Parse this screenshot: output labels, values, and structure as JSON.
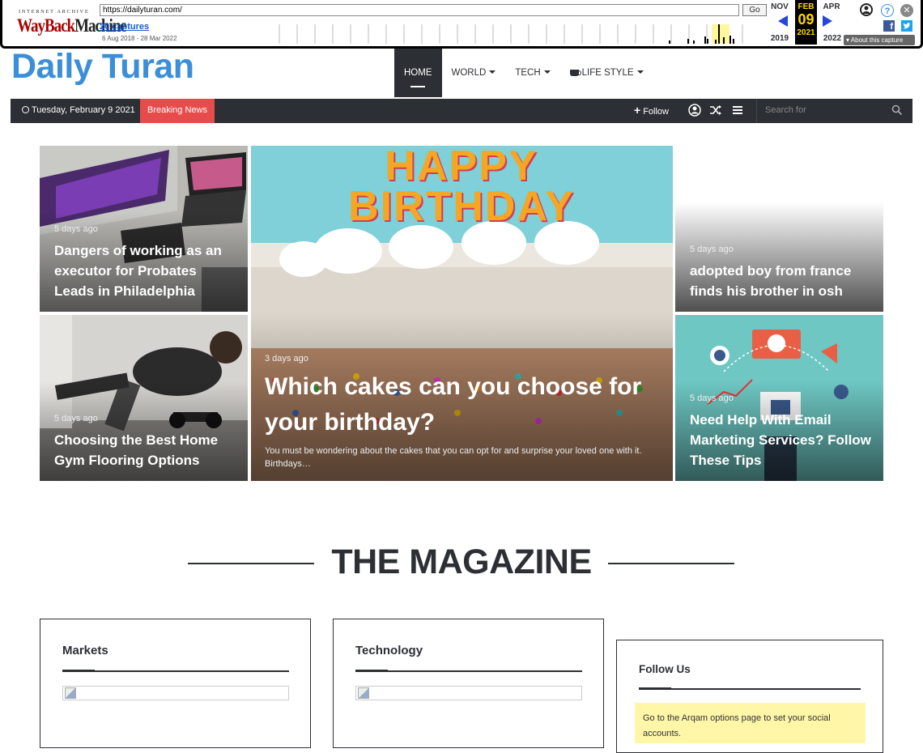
{
  "wayback": {
    "logo_top": "INTERNET ARCHIVE",
    "logo_wordmark_a": "WayBack",
    "logo_wordmark_b": "Machine",
    "url": "https://dailyturan.com/",
    "go_label": "Go",
    "captures": "20 captures",
    "range": "6 Aug 2018 - 28 Mar 2022",
    "prev_month": "NOV",
    "prev_year": "2019",
    "cur_month": "FEB",
    "cur_day": "09",
    "cur_year": "2021",
    "next_month": "APR",
    "next_year": "2022",
    "about": "About this capture"
  },
  "site": {
    "logo": "Daily Turan",
    "nav": [
      {
        "label": "HOME"
      },
      {
        "label": "WORLD"
      },
      {
        "label": "TECH"
      },
      {
        "label": "LIFE STYLE"
      }
    ]
  },
  "topbar": {
    "date": "Tuesday, February 9 2021",
    "breaking": "Breaking News",
    "follow": "Follow",
    "search_placeholder": "Search for"
  },
  "grid": {
    "c1": {
      "meta": "5 days ago",
      "title": "Dangers of working as an executor for Probates Leads in Philadelphia"
    },
    "c2": {
      "meta": "5 days ago",
      "title": "Choosing the Best Home Gym Flooring Options"
    },
    "big": {
      "meta": "3 days ago",
      "title": "Which cakes can you choose for your birthday?",
      "excerpt": "You must be wondering about the cakes that you can opt for and surprise your loved one with it. Birthdays…",
      "cake_text": "HAPPY BIRTHDAY"
    },
    "c3": {
      "meta": "5 days ago",
      "title": "adopted boy from france finds his brother in osh"
    },
    "c4": {
      "meta": "5 days ago",
      "title": "Need Help With Email Marketing Services? Follow These Tips"
    }
  },
  "magazine": {
    "title": "THE MAGAZINE",
    "markets": "Markets",
    "technology": "Technology",
    "follow_us": "Follow Us",
    "notice": "Go to the Arqam options page to set your social accounts."
  },
  "colors": {
    "accent": "#3b8fd8",
    "dark": "#2c2f34",
    "breaking": "#e74c4c",
    "notice": "#fff6a8"
  }
}
